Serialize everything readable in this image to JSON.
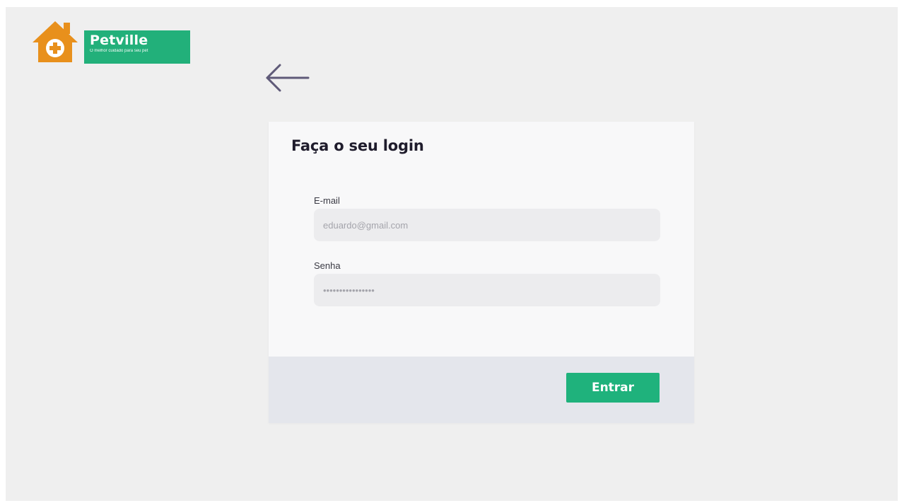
{
  "brand": {
    "name": "Petville",
    "tagline": "O melhor cuidado para seu pet",
    "house_color": "#e8901c",
    "badge_color": "#22b07a"
  },
  "nav": {
    "back_icon": "arrow-left-icon",
    "back_color": "#5f5a78"
  },
  "login": {
    "title": "Faça o seu login",
    "email": {
      "label": "E-mail",
      "placeholder": "eduardo@gmail.com",
      "value": ""
    },
    "password": {
      "label": "Senha",
      "placeholder": "••••••••••••••••",
      "value": ""
    },
    "submit_label": "Entrar"
  },
  "colors": {
    "page_bg": "#efefef",
    "card_bg": "#f8f8f9",
    "footer_bg": "#e4e6ec",
    "input_bg": "#ececee",
    "accent": "#1fb27c",
    "title_text": "#1f1c2c"
  }
}
